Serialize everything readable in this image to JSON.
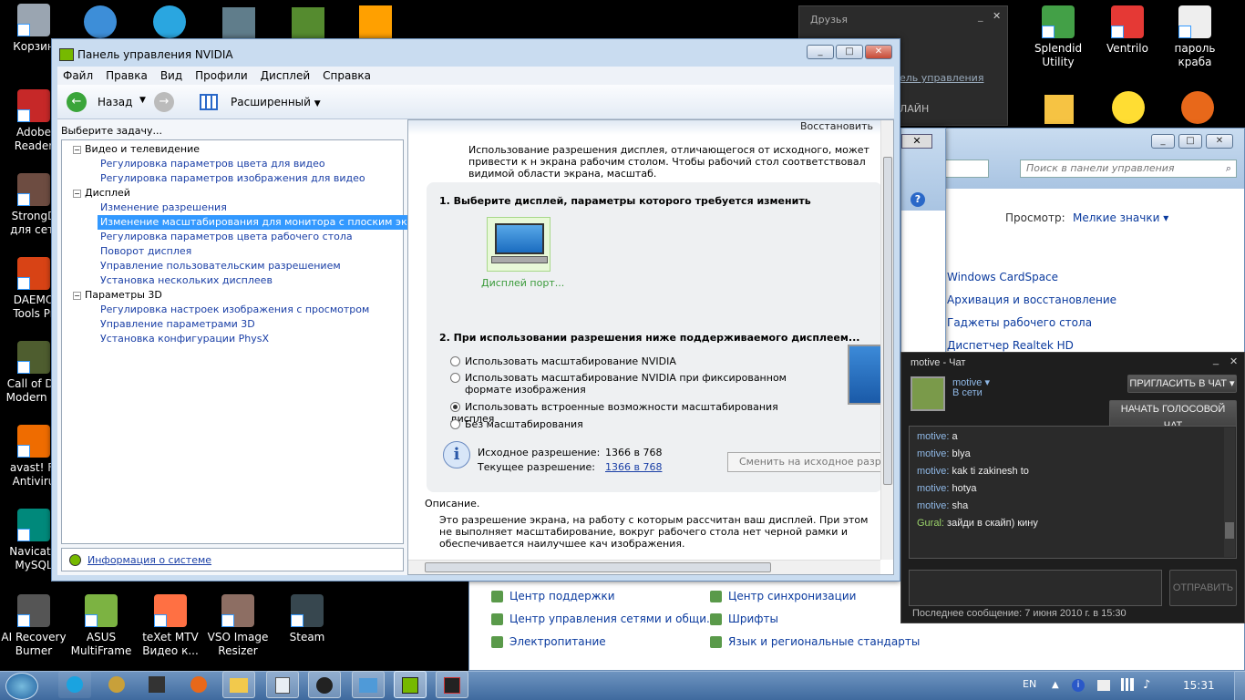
{
  "desktop": {
    "left_icons": [
      {
        "label": "Корзин",
        "color": "#9aa5b1"
      },
      {
        "label": "Adobe Reader",
        "color": "#c62828"
      },
      {
        "label": "StrongD для сет.",
        "color": "#6d4c41"
      },
      {
        "label": "DAEMO Tools Pr",
        "color": "#d84315"
      },
      {
        "label": "Call of Du Modern W",
        "color": "#4e5d2f"
      },
      {
        "label": "avast! Fr Antiviru",
        "color": "#ef6c00"
      },
      {
        "label": "Navicat f MySQL",
        "color": "#00897b"
      },
      {
        "label": "AI Recovery Burner",
        "color": "#555"
      },
      {
        "label": "ASUS MultiFrame",
        "color": "#7cb342"
      },
      {
        "label": "teXet MTV Видео к...",
        "color": "#ff7043"
      },
      {
        "label": "VSO Image Resizer",
        "color": "#8d6e63"
      },
      {
        "label": "Steam",
        "color": "#37474f"
      }
    ],
    "right_icons": [
      {
        "label": "Splendid Utility",
        "color": "#43a047"
      },
      {
        "label": "Ventrilo",
        "color": "#e53935"
      },
      {
        "label": "пароль краба",
        "color": "#eeeeee"
      }
    ]
  },
  "friends_panel": {
    "title": "Друзья",
    "link": "ель управления",
    "status": "ЛАЙН"
  },
  "nvidia": {
    "title": "Панель управления NVIDIA",
    "menu": [
      "Файл",
      "Правка",
      "Вид",
      "Профили",
      "Дисплей",
      "Справка"
    ],
    "toolbar": {
      "back": "Назад",
      "view": "Расширенный"
    },
    "task_label": "Выберите задачу...",
    "tree": [
      {
        "type": "parent",
        "label": "Видео и телевидение"
      },
      {
        "type": "child",
        "label": "Регулировка параметров цвета для видео"
      },
      {
        "type": "child",
        "label": "Регулировка параметров изображения для видео"
      },
      {
        "type": "parent",
        "label": "Дисплей"
      },
      {
        "type": "child",
        "label": "Изменение разрешения"
      },
      {
        "type": "sel",
        "label": "Изменение масштабирования для монитора с плоским экраном"
      },
      {
        "type": "child",
        "label": "Регулировка параметров цвета рабочего стола"
      },
      {
        "type": "child",
        "label": "Поворот дисплея"
      },
      {
        "type": "child",
        "label": "Управление пользовательским разрешением"
      },
      {
        "type": "child",
        "label": "Установка нескольких дисплеев"
      },
      {
        "type": "parent",
        "label": "Параметры 3D"
      },
      {
        "type": "child",
        "label": "Регулировка настроек изображения с просмотром"
      },
      {
        "type": "child",
        "label": "Управление параметрами 3D"
      },
      {
        "type": "child",
        "label": "Установка конфигурации PhysX"
      }
    ],
    "sysinfo": "Информация о системе",
    "restore": "Восстановить",
    "intro": "Использование разрешения дисплея, отличающегося от исходного, может привести к н экрана рабочим столом. Чтобы рабочий стол соответствовал видимой области экрана, масштаб.",
    "step1": "1. Выберите дисплей, параметры которого требуется изменить",
    "display_label": "Дисплей порт...",
    "step2": "2. При использовании разрешения ниже поддерживаемого дисплеем...",
    "options": [
      "Использовать масштабирование NVIDIA",
      "Использовать масштабирование NVIDIA при фиксированном формате изображения",
      "Использовать встроенные возможности масштабирования дисплея",
      "Без масштабирования"
    ],
    "native_label": "Исходное разрешение:",
    "native_value": "1366 в 768",
    "current_label": "Текущее разрешение:",
    "current_value": "1366 в 768",
    "revert_button": "Сменить на исходное разреше",
    "desc_title": "Описание.",
    "desc_text": "Это разрешение экрана, на работу с которым рассчитан ваш дисплей. При этом не выполняет масштабирование, вокруг рабочего стола нет черной рамки и обеспечивается наилучшее кач изображения."
  },
  "control_panel": {
    "search_placeholder": "Поиск в панели управления",
    "view_label": "Просмотр:",
    "view_value": "Мелкие значки",
    "items": [
      "Windows CardSpace",
      "Архивация и восстановление",
      "Гаджеты рабочего стола",
      "Диспетчер Realtek HD"
    ],
    "bottom_items": [
      "Центр поддержки",
      "Центр синхронизации",
      "Центр управления сетями и общи...",
      "Шрифты",
      "Электропитание",
      "Язык и региональные стандарты"
    ]
  },
  "chat": {
    "title": "motive - Чат",
    "user": "motive",
    "status": "В сети",
    "invite": "ПРИГЛАСИТЬ В ЧАТ",
    "voice": "НАЧАТЬ ГОЛОСОВОЙ ЧАТ",
    "messages": [
      {
        "name": "motive",
        "text": "a"
      },
      {
        "name": "motive",
        "text": "blya"
      },
      {
        "name": "motive",
        "text": "kak ti zakinesh to"
      },
      {
        "name": "motive",
        "text": "hotya"
      },
      {
        "name": "motive",
        "text": "sha"
      },
      {
        "name": "Gural",
        "text": "зайди в скайп) кину"
      }
    ],
    "send": "ОТПРАВИТЬ",
    "last": "Последнее сообщение: 7 июня 2010 г. в 15:30"
  },
  "taskbar": {
    "lang": "EN",
    "time": "15:31"
  }
}
